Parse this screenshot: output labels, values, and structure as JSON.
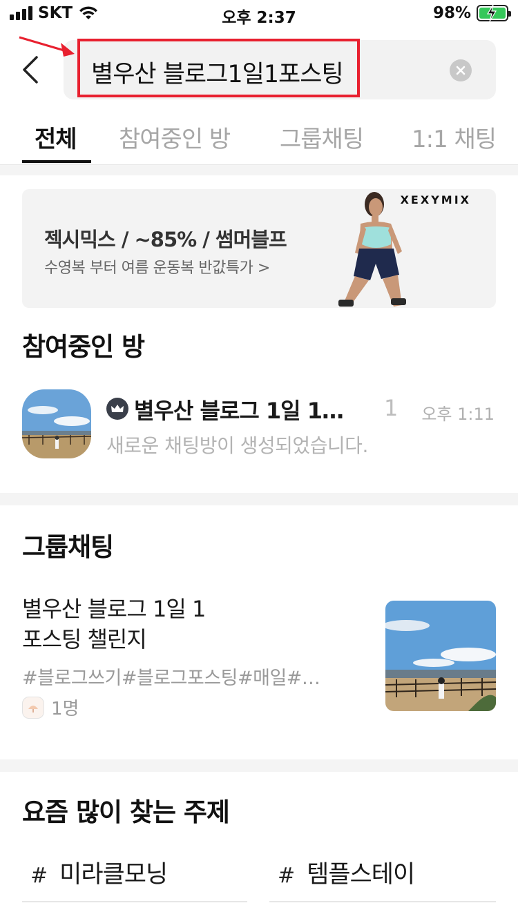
{
  "status_bar": {
    "carrier": "SKT",
    "time": "오후 2:37",
    "battery": "98%"
  },
  "search": {
    "query": "별우산 블로그1일1포스팅"
  },
  "tabs": [
    {
      "label": "전체",
      "active": true
    },
    {
      "label": "참여중인 방",
      "active": false
    },
    {
      "label": "그룹채팅",
      "active": false
    },
    {
      "label": "1:1 채팅",
      "active": false
    }
  ],
  "ad": {
    "brand": "XEXYMIX",
    "title": "젝시믹스 / ~85% / 썸머블프",
    "subtitle": "수영복 부터 여름 운동복 반값특가 >"
  },
  "participating": {
    "title": "참여중인 방",
    "room": {
      "name": "별우산 블로그 1일 1…",
      "count": "1",
      "time": "오후 1:11",
      "message": "새로운 채팅방이 생성되었습니다."
    }
  },
  "group_chat": {
    "title": "그룹채팅",
    "name_line1": "별우산 블로그 1일 1",
    "name_line2": "포스팅 챌린지",
    "tags": "#블로그쓰기#블로그포스팅#매일#…",
    "members": "1명"
  },
  "topics": {
    "title": "요즘 많이 찾는 주제",
    "hash": "#",
    "items": [
      "미라클모닝",
      "템플스테이"
    ]
  },
  "colors": {
    "highlight_red": "#e8202f",
    "battery_green": "#34c759"
  }
}
